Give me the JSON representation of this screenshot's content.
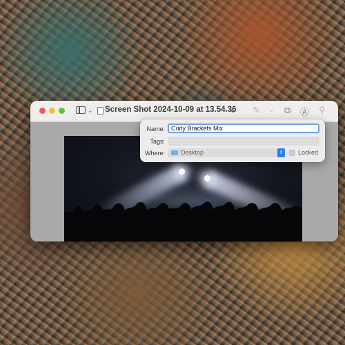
{
  "window": {
    "title": "Screen Shot 2024-10-09 at 13.54.36",
    "partial_text": "S"
  },
  "toolbar": {
    "icons": [
      "sidebar-icon",
      "chevron-down-icon",
      "document-icon",
      "pencil-icon",
      "share-icon",
      "markup-icon",
      "search-icon"
    ]
  },
  "save_popover": {
    "name_label": "Name:",
    "name_value": "Curly Brackets Mix",
    "tags_label": "Tags:",
    "tags_value": "",
    "where_label": "Where:",
    "where_value": "Desktop",
    "locked_label": "Locked",
    "locked_checked": false
  },
  "colors": {
    "accent": "#2a7ef2",
    "focus_ring": "#6ea1e6"
  }
}
